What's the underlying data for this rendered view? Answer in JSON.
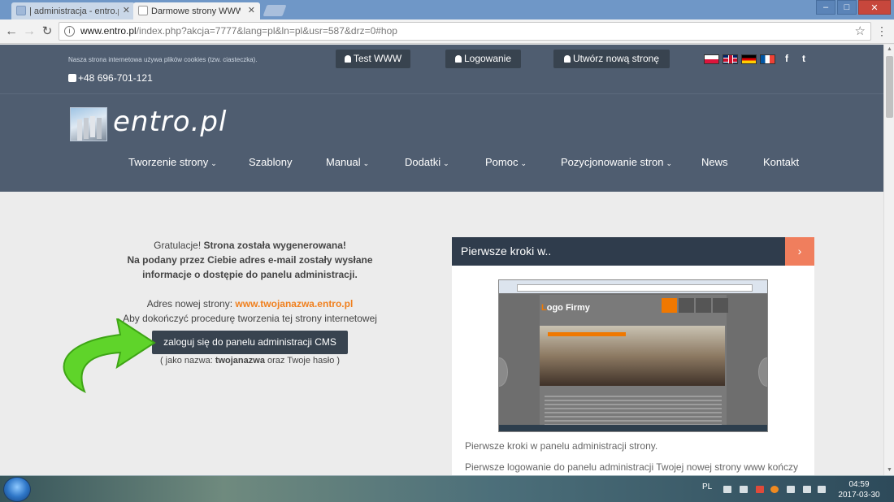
{
  "browser": {
    "tabs": [
      {
        "title": "| administracja - entro.pl",
        "active": false
      },
      {
        "title": "Darmowe strony WWW",
        "active": true
      }
    ],
    "url_host": "www.entro.pl",
    "url_rest": "/index.php?akcja=7777&lang=pl&ln=pl&usr=587&drz=0#hop"
  },
  "topbar": {
    "cookie_note": "Nasza strona internetowa używa plików cookies (tzw. ciasteczka).",
    "phone": "+48 696-701-121",
    "buttons": {
      "test": "Test WWW",
      "login": "Logowanie",
      "create": "Utwórz nową stronę"
    },
    "social": {
      "facebook": "f",
      "twitter": "t"
    }
  },
  "header": {
    "logo_text": "entro.pl",
    "nav": [
      {
        "label": "Tworzenie strony",
        "dropdown": true
      },
      {
        "label": "Szablony",
        "dropdown": false
      },
      {
        "label": "Manual",
        "dropdown": true
      },
      {
        "label": "Dodatki",
        "dropdown": true
      },
      {
        "label": "Pomoc",
        "dropdown": true
      },
      {
        "label": "Pozycjonowanie stron",
        "dropdown": true
      },
      {
        "label": "News",
        "dropdown": false
      },
      {
        "label": "Kontakt",
        "dropdown": false
      }
    ]
  },
  "main": {
    "congrats_pre": "Gratulacje! ",
    "congrats_bold": "Strona została wygenerowana!",
    "email_line1": "Na podany przez Ciebie adres e-mail zostały wysłane",
    "email_line2": "informacje o dostępie do panelu administracji.",
    "address_label": "Adres nowej strony: ",
    "address_value": "www.twojanazwa.entro.pl",
    "finish_text": "Aby dokończyć procedurę tworzenia tej strony internetowej",
    "cms_button": "zaloguj się do panelu administracji CMS",
    "hint_pre": "( jako nazwa: ",
    "hint_name": "twojanazwa",
    "hint_post": " oraz Twoje hasło )"
  },
  "panel": {
    "title": "Pierwsze kroki w..",
    "next": "›",
    "shot_logo_a": "L",
    "shot_logo_b": "ogo Firmy",
    "caption": "Pierwsze kroki w panelu administracji strony.",
    "description": "Pierwsze logowanie do panelu administracji Twojej nowej strony www kończy"
  },
  "taskbar": {
    "lang": "PL",
    "time": "04:59",
    "date": "2017-03-30"
  },
  "colors": {
    "site_dark": "#4f5d70",
    "button_dark": "#38434f",
    "accent_orange": "#f0801e",
    "panel_next": "#f07e5d",
    "arrow_green": "#5fd42a"
  }
}
